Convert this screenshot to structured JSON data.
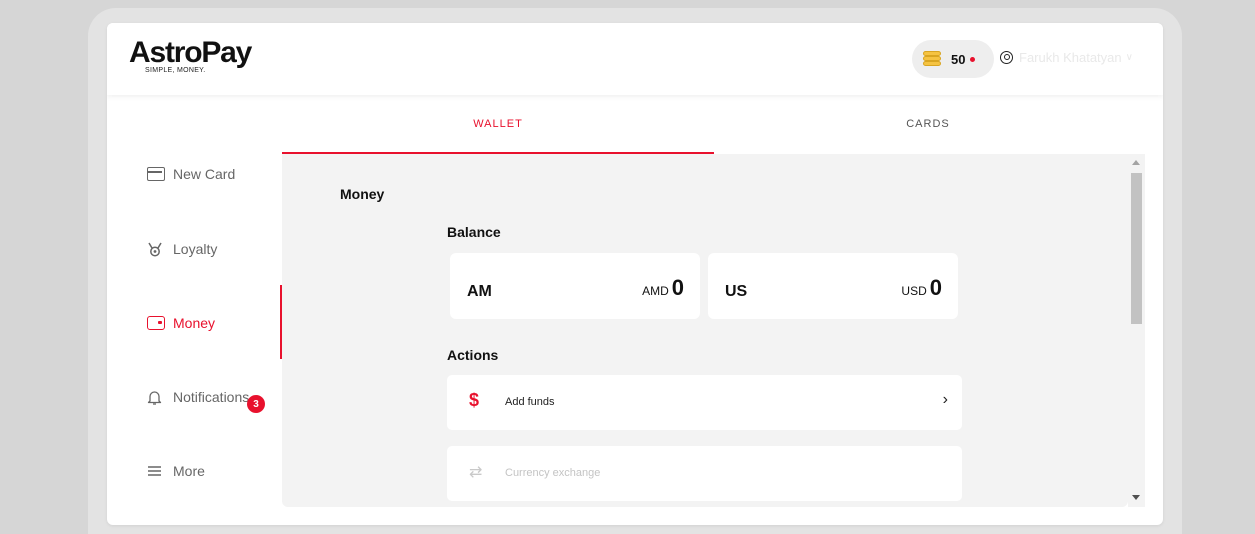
{
  "brand": {
    "logo_text": "AstroPay",
    "tagline": "SIMPLE, MONEY."
  },
  "header": {
    "points": "50",
    "user_name": "Farukh Khatatyan",
    "user_chevron": "∨"
  },
  "sidebar": {
    "items": [
      {
        "label": "New Card",
        "icon": "card-icon"
      },
      {
        "label": "Loyalty",
        "icon": "medal-icon"
      },
      {
        "label": "Money",
        "icon": "wallet-icon",
        "active": true
      },
      {
        "label": "Notifications",
        "icon": "bell-icon",
        "badge": "3"
      },
      {
        "label": "More",
        "icon": "menu-icon"
      }
    ]
  },
  "tabs": [
    {
      "label": "WALLET",
      "active": true
    },
    {
      "label": "CARDS",
      "active": false
    }
  ],
  "main": {
    "section_title": "Money",
    "balance_title": "Balance",
    "balances": [
      {
        "code": "AM",
        "currency": "AMD",
        "amount": "0"
      },
      {
        "code": "US",
        "currency": "USD",
        "amount": "0"
      }
    ],
    "actions_title": "Actions",
    "actions": [
      {
        "label": "Add funds",
        "icon": "$",
        "chevron": "›",
        "enabled": true
      },
      {
        "label": "Currency exchange",
        "icon": "⇄",
        "enabled": false
      }
    ]
  },
  "colors": {
    "accent": "#e8112d",
    "panel_bg": "#f3f3f3",
    "coin": "#f5c342"
  }
}
